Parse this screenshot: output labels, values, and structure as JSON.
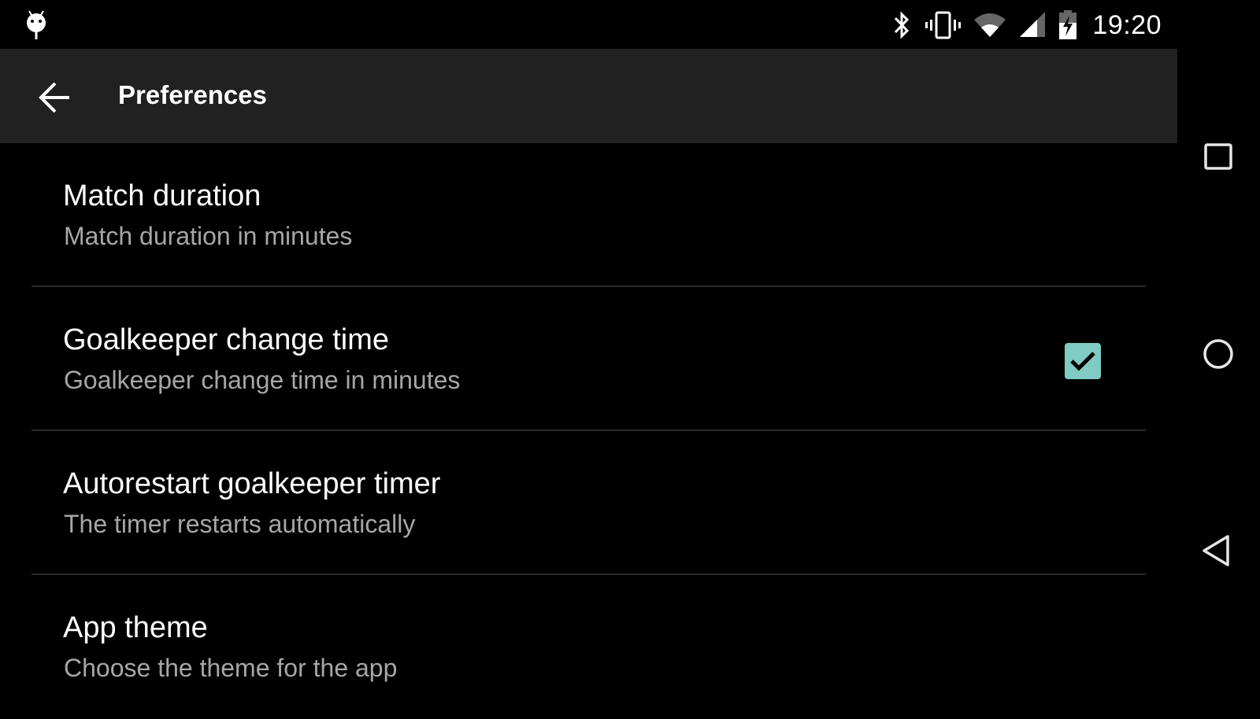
{
  "status_bar": {
    "notification_icon": "android-debug-icon",
    "icons": [
      "bluetooth-icon",
      "vibrate-icon",
      "wifi-icon",
      "cell-signal-icon",
      "battery-charging-icon"
    ],
    "time": "19:20"
  },
  "app_bar": {
    "back_icon": "arrow-back-icon",
    "title": "Preferences"
  },
  "preferences": [
    {
      "title": "Match duration",
      "summary": "Match duration in minutes"
    },
    {
      "title": "Goalkeeper change time",
      "summary": "Goalkeeper change time in minutes"
    },
    {
      "title": "Autorestart goalkeeper timer",
      "summary": "The timer restarts automatically",
      "checked": true
    },
    {
      "title": "App theme",
      "summary": "Choose the theme for the app"
    }
  ],
  "nav_bar": {
    "buttons": [
      "recents-icon",
      "home-icon",
      "back-icon"
    ]
  },
  "colors": {
    "accent": "#80cbc4",
    "app_bar": "#212121",
    "background": "#000000",
    "summary_text": "#a6a6a6"
  }
}
